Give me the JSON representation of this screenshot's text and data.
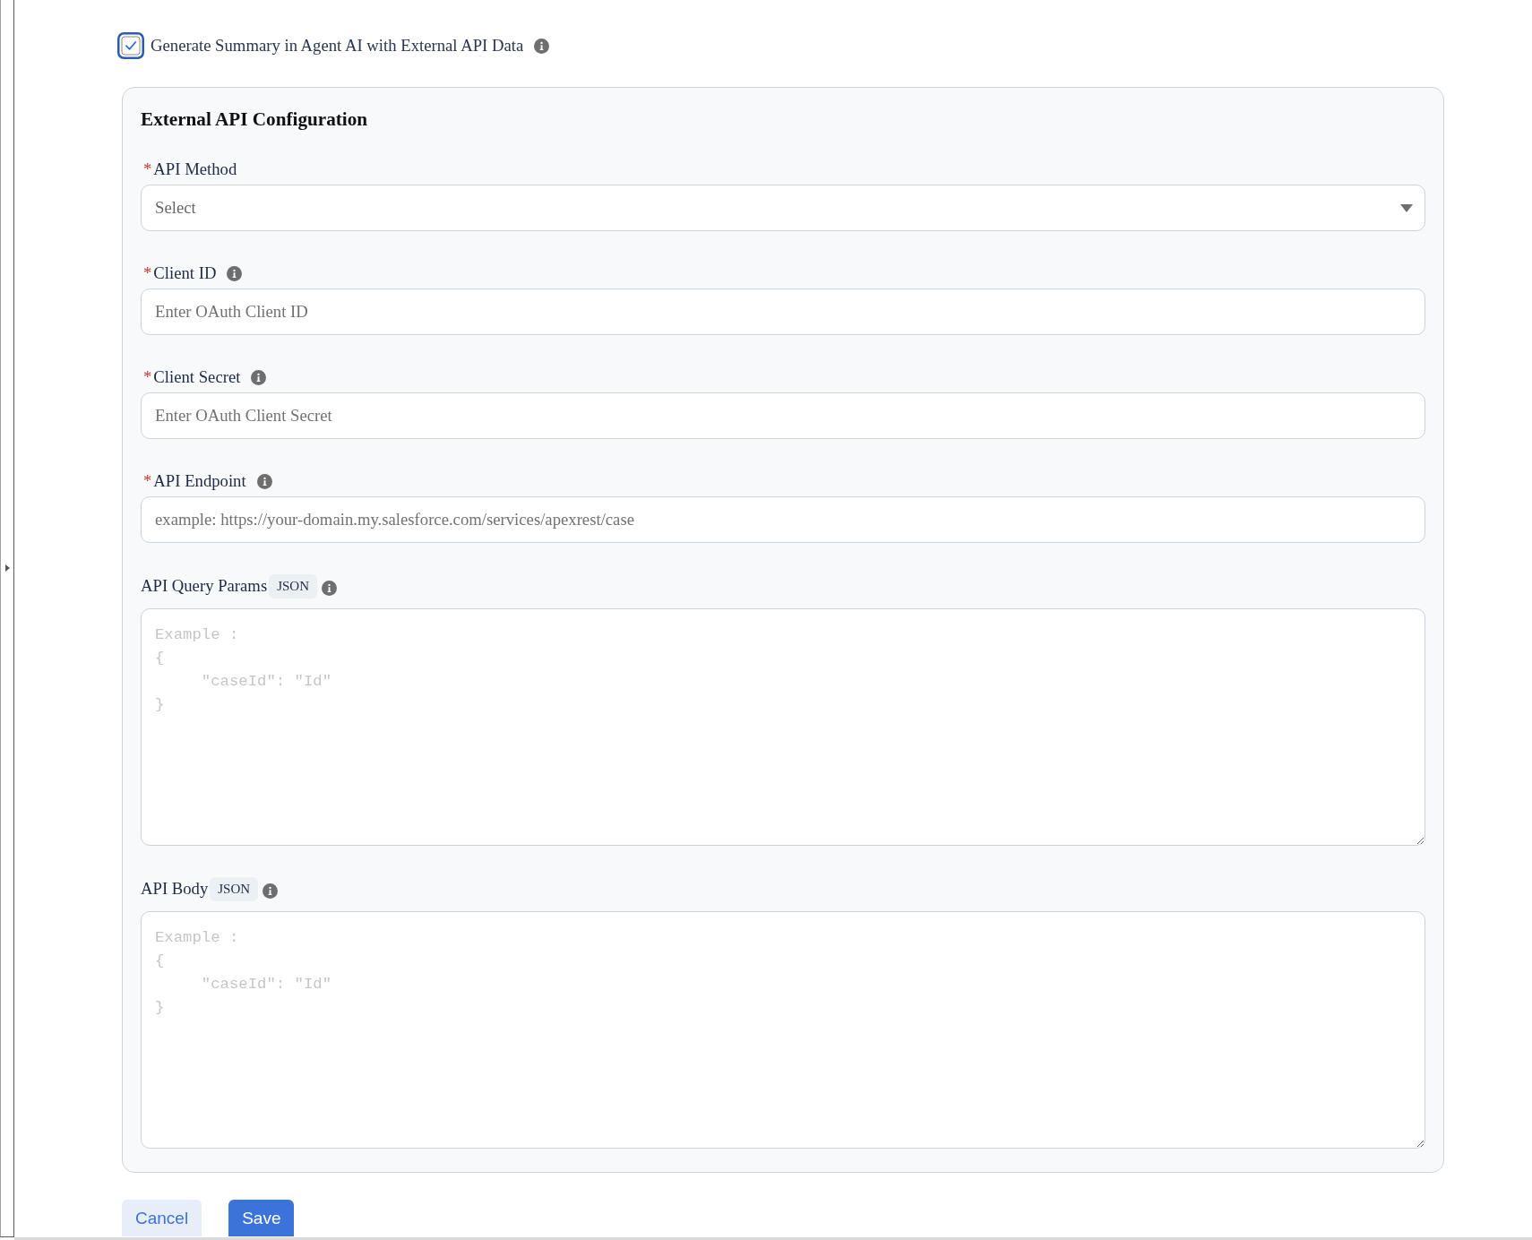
{
  "generate_summary": {
    "label": "Generate Summary in Agent AI with External API Data",
    "checked": true,
    "info": true
  },
  "external_api_configuration": {
    "title": "External API Configuration",
    "fields": [
      {
        "kind": "select",
        "required_mark": "*",
        "label": "API Method",
        "info": false,
        "placeholder": "Select"
      },
      {
        "kind": "text",
        "required_mark": "*",
        "label": "Client ID",
        "info": true,
        "placeholder": "Enter OAuth Client ID"
      },
      {
        "kind": "text",
        "required_mark": "*",
        "label": "Client Secret",
        "info": true,
        "placeholder": "Enter OAuth Client Secret"
      },
      {
        "kind": "text",
        "required_mark": "*",
        "label": "API Endpoint",
        "info": true,
        "placeholder": "example: https://your-domain.my.salesforce.com/services/apexrest/case"
      },
      {
        "kind": "json",
        "label": "API Query Params",
        "badge": "JSON",
        "info": true,
        "placeholder": "Example :\n{\n     \"caseId\": \"Id\"\n}"
      },
      {
        "kind": "json",
        "label": "API Body",
        "badge": "JSON",
        "info": true,
        "placeholder": "Example :\n{\n     \"caseId\": \"Id\"\n}"
      }
    ]
  },
  "buttons": [
    {
      "kind": "secondary",
      "label": "Cancel"
    },
    {
      "kind": "primary",
      "label": "Save"
    }
  ]
}
